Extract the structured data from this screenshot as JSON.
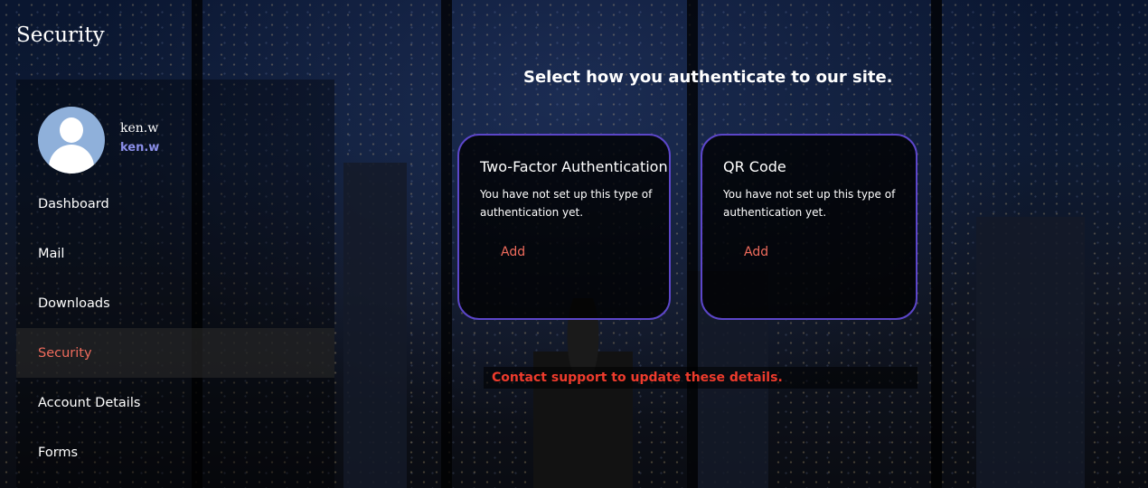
{
  "app": {
    "title": "Security"
  },
  "user": {
    "name": "ken.w",
    "handle": "ken.w",
    "avatar_icon": "user-avatar-icon"
  },
  "sidebar": {
    "items": [
      {
        "label": "Dashboard",
        "active": false
      },
      {
        "label": "Mail",
        "active": false
      },
      {
        "label": "Downloads",
        "active": false
      },
      {
        "label": "Security",
        "active": true
      },
      {
        "label": "Account Details",
        "active": false
      },
      {
        "label": "Forms",
        "active": false
      }
    ]
  },
  "main": {
    "prompt": "Select how you authenticate to our site.",
    "methods": [
      {
        "title": "Two-Factor Authentication",
        "status": "You have not set up this type of authentication yet.",
        "action": "Add"
      },
      {
        "title": "QR Code",
        "status": "You have not set up this type of authentication yet.",
        "action": "Add"
      }
    ],
    "notice": "Contact support to update these details."
  },
  "colors": {
    "accent": "#ef6b5c",
    "card_border": "#5c46c9",
    "handle": "#8a8ee8",
    "notice": "#ee3b2c"
  }
}
